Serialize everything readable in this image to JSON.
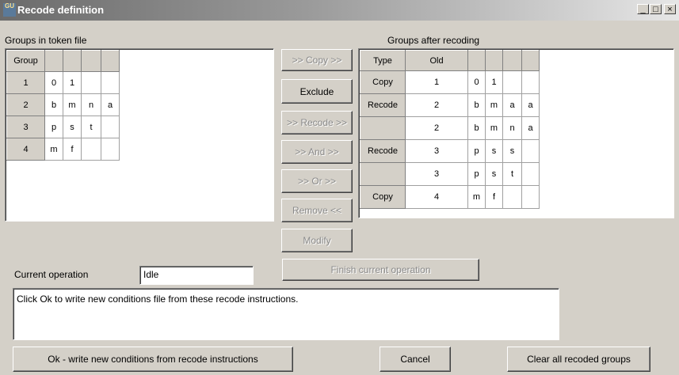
{
  "window": {
    "title": "Recode definition",
    "icon_text": "GU",
    "controls": {
      "minimize": "_",
      "maximize": "□",
      "close": "×"
    }
  },
  "left": {
    "label": "Groups in token file",
    "header": [
      "Group",
      "",
      "",
      "",
      ""
    ],
    "rows": [
      [
        "1",
        "0",
        "1",
        "",
        ""
      ],
      [
        "2",
        "b",
        "m",
        "n",
        "a"
      ],
      [
        "3",
        "p",
        "s",
        "t",
        ""
      ],
      [
        "4",
        "m",
        "f",
        "",
        ""
      ]
    ]
  },
  "right": {
    "label": "Groups after recoding",
    "header": [
      "Type",
      "Old",
      "",
      "",
      "",
      ""
    ],
    "rows": [
      [
        "Copy",
        "1",
        "0",
        "1",
        "",
        ""
      ],
      [
        "Recode",
        "2",
        "b",
        "m",
        "a",
        "a"
      ],
      [
        "",
        "2",
        "b",
        "m",
        "n",
        "a"
      ],
      [
        "Recode",
        "3",
        "p",
        "s",
        "s",
        ""
      ],
      [
        "",
        "3",
        "p",
        "s",
        "t",
        ""
      ],
      [
        "Copy",
        "4",
        "m",
        "f",
        "",
        ""
      ]
    ]
  },
  "middle_buttons": {
    "copy": ">> Copy >>",
    "exclude": "Exclude",
    "recode": ">> Recode >>",
    "and": ">> And >>",
    "or": ">> Or >>",
    "remove": "Remove <<",
    "modify": "Modify"
  },
  "current_operation": {
    "label": "Current operation",
    "value": "Idle"
  },
  "finish_button": "Finish current operation",
  "message": "Click Ok to write new conditions file from these recode instructions.",
  "bottom_buttons": {
    "ok": "Ok - write new conditions from recode instructions",
    "cancel": "Cancel",
    "clear": "Clear all recoded groups"
  }
}
